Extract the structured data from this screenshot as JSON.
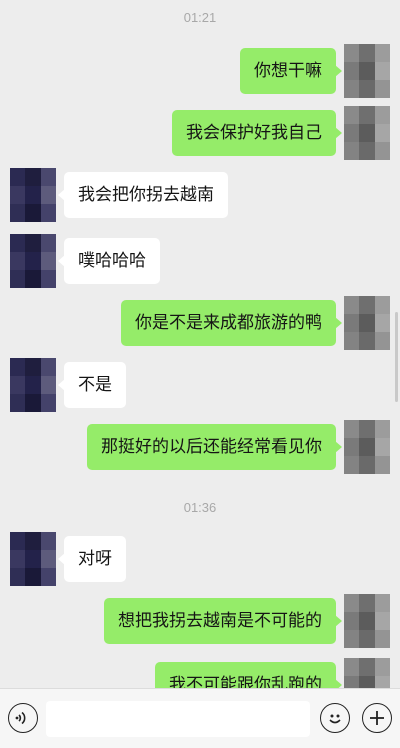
{
  "timestamps": [
    "01:21",
    "01:36"
  ],
  "messages": [
    {
      "side": "out",
      "text": "你想干嘛"
    },
    {
      "side": "out",
      "text": "我会保护好我自己"
    },
    {
      "side": "in",
      "text": "我会把你拐去越南"
    },
    {
      "side": "in",
      "text": "噗哈哈哈"
    },
    {
      "side": "out",
      "text": "你是不是来成都旅游的鸭"
    },
    {
      "side": "in",
      "text": "不是"
    },
    {
      "side": "out",
      "text": "那挺好的以后还能经常看见你"
    },
    {
      "side": "in",
      "text": "对呀"
    },
    {
      "side": "out",
      "text": "想把我拐去越南是不可能的"
    },
    {
      "side": "out",
      "text": "我不可能跟你乱跑的"
    }
  ],
  "colors": {
    "out_bubble": "#95ec69",
    "in_bubble": "#ffffff",
    "background": "#ededed"
  },
  "input_bar": {
    "voice_icon": "voice-icon",
    "emoji_icon": "emoji-icon",
    "plus_icon": "plus-icon",
    "input_value": ""
  }
}
